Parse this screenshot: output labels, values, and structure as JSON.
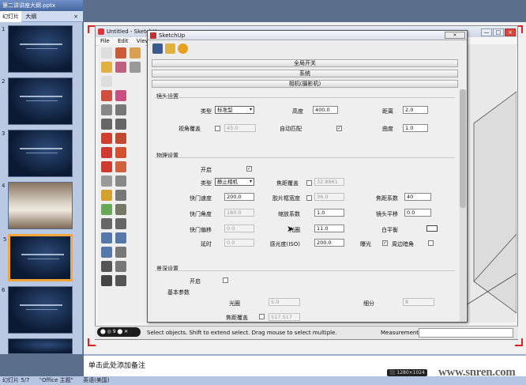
{
  "ppt": {
    "title": "第二讲讲座大纲.pptx",
    "tabs": [
      "幻灯片",
      "大纲"
    ],
    "close": "×",
    "slide_numbers": [
      "1",
      "2",
      "3",
      "4",
      "5",
      "6",
      "7"
    ],
    "notes_placeholder": "单击此处添加备注",
    "status": {
      "slide": "幻灯片 5/7",
      "theme": "\"Office 主题\"",
      "lang": "英语(美国)"
    }
  },
  "sketchup": {
    "window_title": "Untitled - SketchUp",
    "menu": [
      "File",
      "Edit",
      "View"
    ],
    "win_buttons": [
      "—",
      "□",
      "×"
    ],
    "status_message": "Select objects. Shift to extend select. Drag mouse to select multiple.",
    "measurements_label": "Measurements",
    "badge": "⬤ ◎ 9 ⬤ ✕"
  },
  "dialog": {
    "title": "SketchUp",
    "close": "×",
    "sections": [
      "全局开关",
      "系统",
      "相机(摄影机)"
    ],
    "lens": {
      "title": "镜头设置",
      "type_label": "类型",
      "type_value": "标准型",
      "height_label": "高度",
      "height_value": "400.0",
      "distance_label": "距离",
      "distance_value": "2.0",
      "fov_label": "视角覆盖",
      "fov_value": "45.0",
      "auto_label": "自动匹配",
      "auto_checked": "✓",
      "curve_label": "曲度",
      "curve_value": "1.0"
    },
    "physical": {
      "title": "物理设置",
      "on_label": "开启",
      "on_checked": "✓",
      "type_label": "类型",
      "type_value": "静止相机",
      "focal_override_label": "焦距覆盖",
      "focal_override_value": "32.8861",
      "shutter_label": "快门速度",
      "shutter_value": "200.0",
      "film_label": "胶片框宽度",
      "film_value": "36.0",
      "focal_factor_label": "焦距系数",
      "focal_factor_value": "40",
      "shutter_angle_label": "快门角度",
      "shutter_angle_value": "180.0",
      "zoom_label": "缩放系数",
      "zoom_value": "1.0",
      "shift_label": "镜头平移",
      "shift_value": "0.0",
      "shutter_offset_label": "快门偏移",
      "shutter_offset_value": "0.0",
      "fnumber_label": "光圈",
      "fnumber_value": "11.0",
      "wb_label": "白平衡",
      "latency_label": "延时",
      "latency_value": "0.0",
      "iso_label": "感光度(ISO)",
      "iso_value": "200.0",
      "exposure_label": "曝光",
      "exposure_checked": "✓",
      "vignette_label": "周边暗角"
    },
    "dof": {
      "title": "景深设置",
      "on_label": "开启",
      "basic_label": "基本参数",
      "aperture_label": "光圈",
      "aperture_value": "5.0",
      "subdiv_label": "细分",
      "subdiv_value": "8",
      "focal_override_label": "焦距覆盖",
      "focal_override_value": "517.517"
    }
  },
  "watermark": "www.snren.com",
  "resolution_tag": "⬛ 1280×1024",
  "colors": {
    "accent_red": "#e02020",
    "selected_slide": "#f4a63a"
  }
}
